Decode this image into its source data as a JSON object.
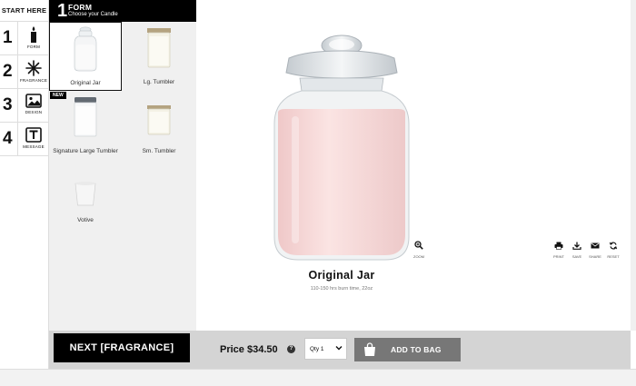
{
  "rail": {
    "start_here": "START HERE",
    "steps": [
      {
        "number": "1",
        "label": "FORM",
        "icon": "candle-icon"
      },
      {
        "number": "2",
        "label": "FRAGRANCE",
        "icon": "fragrance-icon"
      },
      {
        "number": "3",
        "label": "DESIGN",
        "icon": "image-icon"
      },
      {
        "number": "4",
        "label": "MESSAGE",
        "icon": "text-icon"
      }
    ]
  },
  "panel": {
    "step_number": "1",
    "title": "FORM",
    "subtitle": "Choose your Candle",
    "items": [
      {
        "name": "Original Jar",
        "selected": true
      },
      {
        "name": "Lg. Tumbler"
      },
      {
        "name": "Signature Large Tumbler",
        "badge": "NEW"
      },
      {
        "name": "Sm. Tumbler"
      },
      {
        "name": "Votive"
      }
    ]
  },
  "preview": {
    "product_name": "Original Jar",
    "product_meta": "110-150 hrs burn time, 22oz",
    "zoom_label": "ZOOM",
    "tools": [
      {
        "label": "PRINT",
        "icon": "print-icon"
      },
      {
        "label": "SAVE",
        "icon": "download-icon"
      },
      {
        "label": "SHARE",
        "icon": "mail-icon"
      },
      {
        "label": "RESET",
        "icon": "refresh-icon"
      }
    ]
  },
  "bottombar": {
    "next_label": "NEXT [FRAGRANCE]",
    "price": "Price $34.50",
    "info": "?",
    "qty": "Qty 1",
    "add_label": "ADD TO BAG"
  },
  "colors": {
    "accent": "#000000",
    "panel_bg": "#f0f0f0",
    "add_button": "#777777",
    "candle_wax": "#f8dcdc"
  }
}
